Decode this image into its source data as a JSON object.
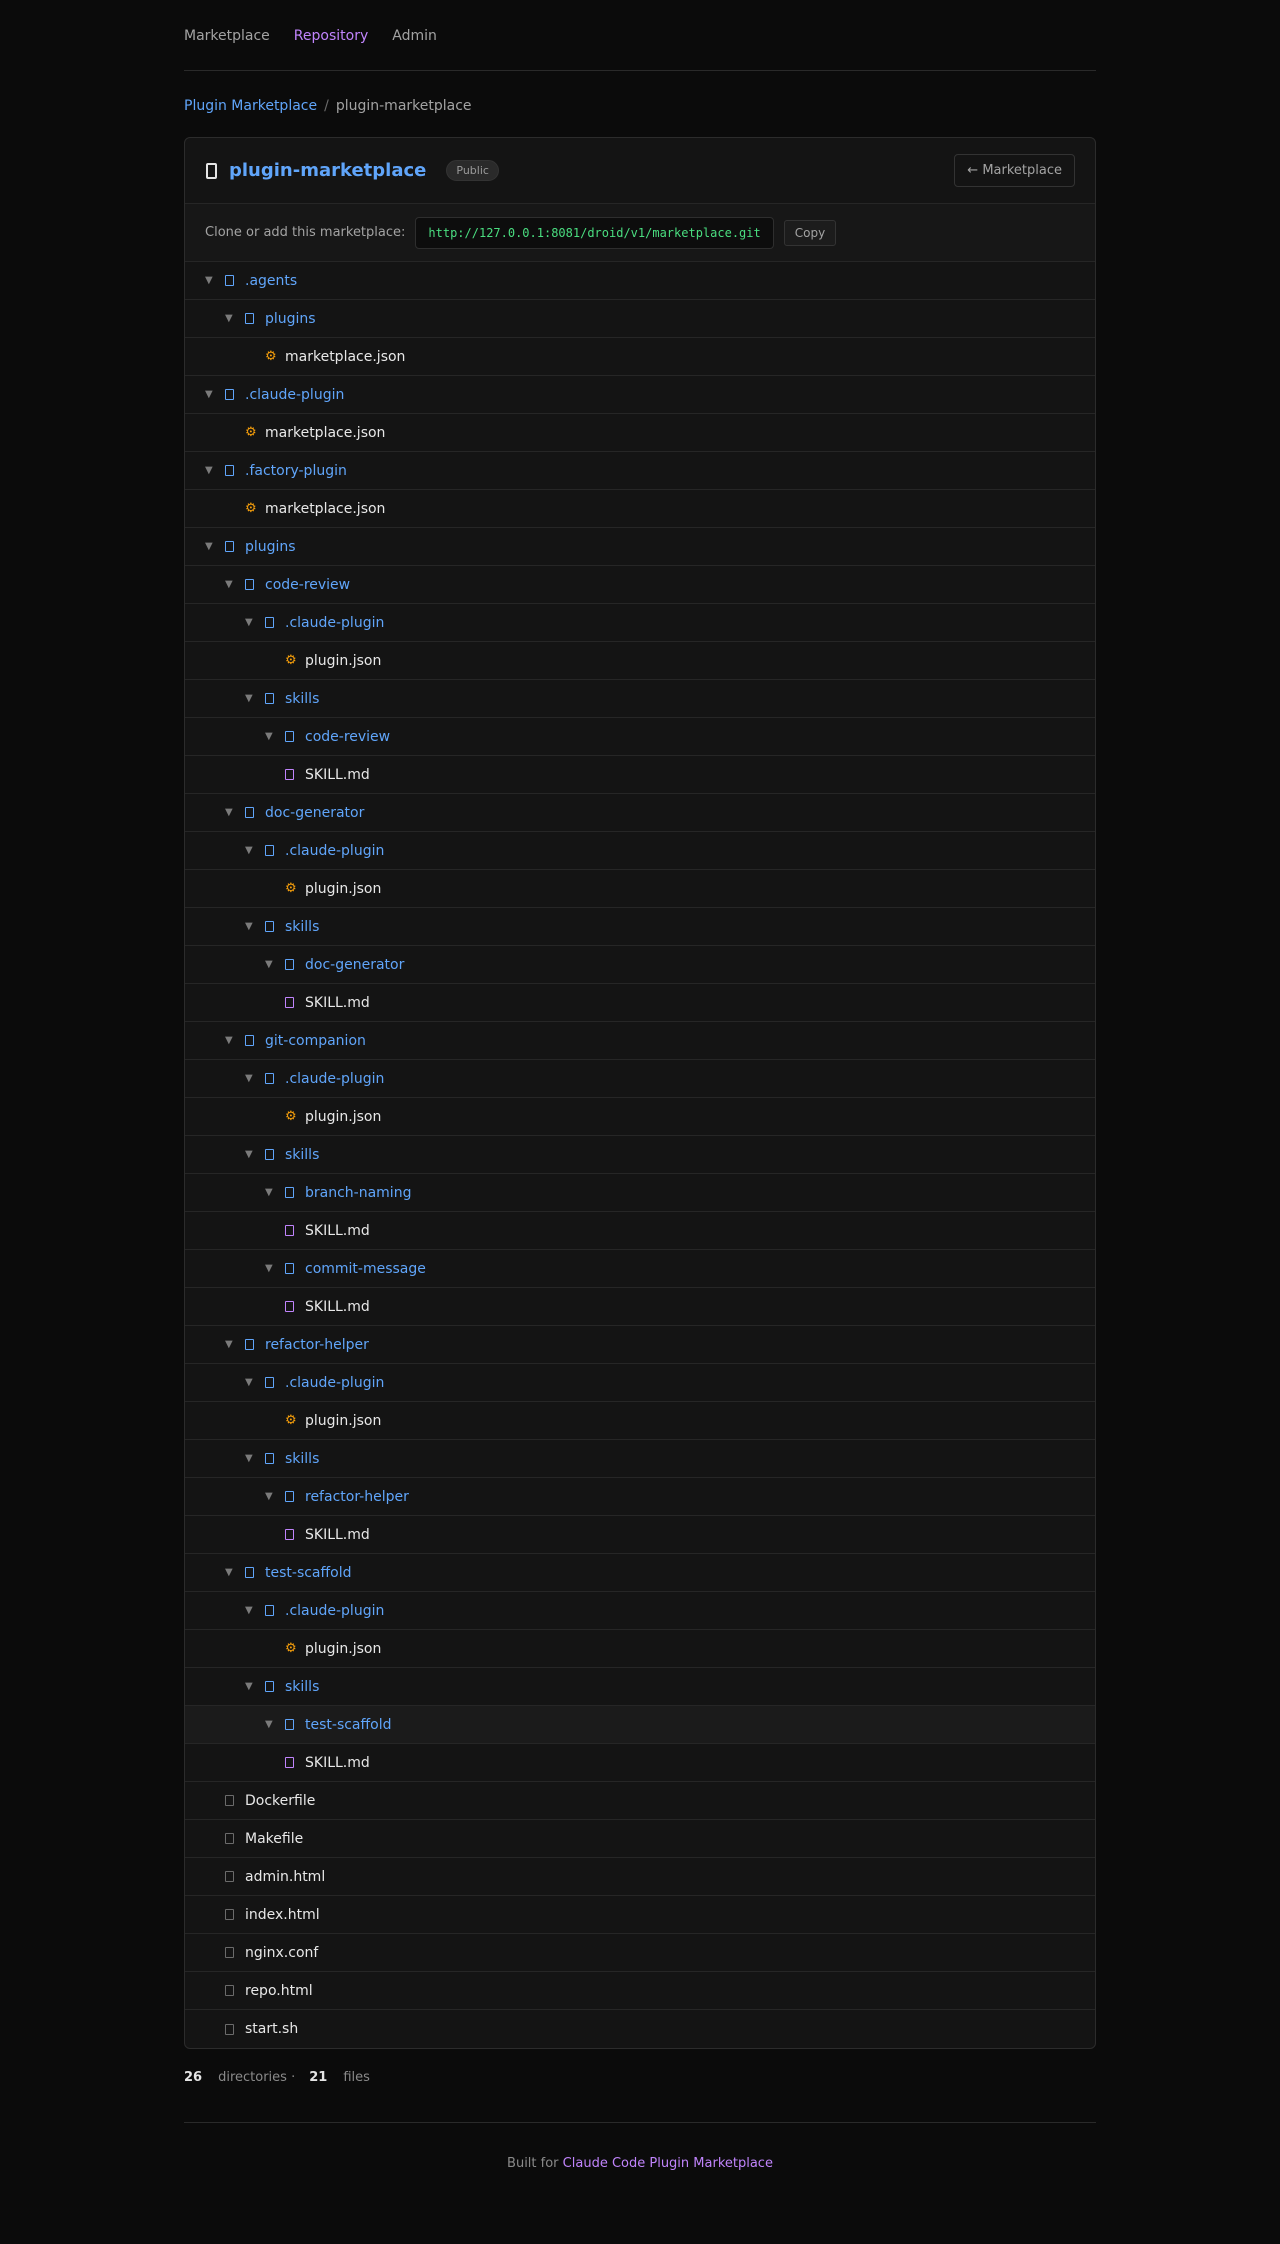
{
  "nav": {
    "items": [
      {
        "label": "Marketplace",
        "active": false
      },
      {
        "label": "Repository",
        "active": true
      },
      {
        "label": "Admin",
        "active": false
      }
    ]
  },
  "breadcrumb": {
    "link": "Plugin Marketplace",
    "separator": "/",
    "current": "plugin-marketplace"
  },
  "repo": {
    "title": "plugin-marketplace",
    "visibility": "Public",
    "back_label": "← Marketplace",
    "clone_label": "Clone or add this marketplace:",
    "clone_url": "http://127.0.0.1:8081/droid/v1/marketplace.git",
    "copy_label": "Copy"
  },
  "tree": [
    {
      "name": ".agents",
      "type": "dir",
      "depth": 0
    },
    {
      "name": "plugins",
      "type": "dir",
      "depth": 1
    },
    {
      "name": "marketplace.json",
      "type": "json",
      "depth": 2
    },
    {
      "name": ".claude-plugin",
      "type": "dir",
      "depth": 0
    },
    {
      "name": "marketplace.json",
      "type": "json",
      "depth": 1
    },
    {
      "name": ".factory-plugin",
      "type": "dir",
      "depth": 0
    },
    {
      "name": "marketplace.json",
      "type": "json",
      "depth": 1
    },
    {
      "name": "plugins",
      "type": "dir",
      "depth": 0
    },
    {
      "name": "code-review",
      "type": "dir",
      "depth": 1
    },
    {
      "name": ".claude-plugin",
      "type": "dir",
      "depth": 2
    },
    {
      "name": "plugin.json",
      "type": "json",
      "depth": 3
    },
    {
      "name": "skills",
      "type": "dir",
      "depth": 2
    },
    {
      "name": "code-review",
      "type": "dir",
      "depth": 3
    },
    {
      "name": "SKILL.md",
      "type": "md",
      "depth": 3
    },
    {
      "name": "doc-generator",
      "type": "dir",
      "depth": 1
    },
    {
      "name": ".claude-plugin",
      "type": "dir",
      "depth": 2
    },
    {
      "name": "plugin.json",
      "type": "json",
      "depth": 3
    },
    {
      "name": "skills",
      "type": "dir",
      "depth": 2
    },
    {
      "name": "doc-generator",
      "type": "dir",
      "depth": 3
    },
    {
      "name": "SKILL.md",
      "type": "md",
      "depth": 3
    },
    {
      "name": "git-companion",
      "type": "dir",
      "depth": 1
    },
    {
      "name": ".claude-plugin",
      "type": "dir",
      "depth": 2
    },
    {
      "name": "plugin.json",
      "type": "json",
      "depth": 3
    },
    {
      "name": "skills",
      "type": "dir",
      "depth": 2
    },
    {
      "name": "branch-naming",
      "type": "dir",
      "depth": 3
    },
    {
      "name": "SKILL.md",
      "type": "md",
      "depth": 3
    },
    {
      "name": "commit-message",
      "type": "dir",
      "depth": 3
    },
    {
      "name": "SKILL.md",
      "type": "md",
      "depth": 3
    },
    {
      "name": "refactor-helper",
      "type": "dir",
      "depth": 1
    },
    {
      "name": ".claude-plugin",
      "type": "dir",
      "depth": 2
    },
    {
      "name": "plugin.json",
      "type": "json",
      "depth": 3
    },
    {
      "name": "skills",
      "type": "dir",
      "depth": 2
    },
    {
      "name": "refactor-helper",
      "type": "dir",
      "depth": 3
    },
    {
      "name": "SKILL.md",
      "type": "md",
      "depth": 3
    },
    {
      "name": "test-scaffold",
      "type": "dir",
      "depth": 1
    },
    {
      "name": ".claude-plugin",
      "type": "dir",
      "depth": 2
    },
    {
      "name": "plugin.json",
      "type": "json",
      "depth": 3
    },
    {
      "name": "skills",
      "type": "dir",
      "depth": 2
    },
    {
      "name": "test-scaffold",
      "type": "dir",
      "depth": 3,
      "highlighted": true
    },
    {
      "name": "SKILL.md",
      "type": "md",
      "depth": 3
    },
    {
      "name": "Dockerfile",
      "type": "file",
      "depth": 0
    },
    {
      "name": "Makefile",
      "type": "file",
      "depth": 0
    },
    {
      "name": "admin.html",
      "type": "file",
      "depth": 0
    },
    {
      "name": "index.html",
      "type": "file",
      "depth": 0
    },
    {
      "name": "nginx.conf",
      "type": "file",
      "depth": 0
    },
    {
      "name": "repo.html",
      "type": "file",
      "depth": 0
    },
    {
      "name": "start.sh",
      "type": "file",
      "depth": 0
    }
  ],
  "icons": {
    "dir": "folder-icon",
    "json": "gear-icon",
    "md": "markdown-file-icon",
    "file": "file-icon",
    "caret": "caret-down-icon",
    "repo": "repo-icon"
  },
  "stats": {
    "dir_count": "26",
    "dir_label": "directories ·",
    "file_count": "21",
    "file_label": "files"
  },
  "footer": {
    "prefix": "Built for",
    "link": "Claude Code Plugin Marketplace"
  },
  "colors": {
    "accent": "#60a5fa",
    "active_nav": "#c084fc",
    "url": "#4ade80",
    "json_icon": "#f59e0b"
  }
}
